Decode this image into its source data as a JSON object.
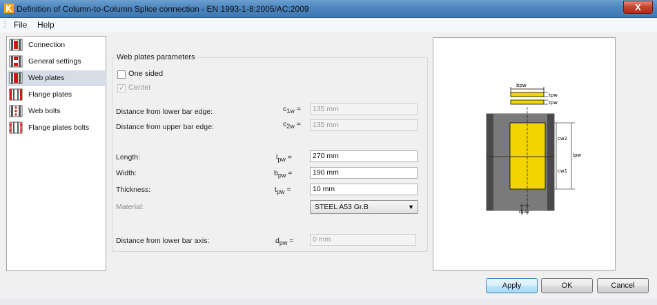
{
  "window": {
    "title": "Definition of Column-to-Column Splice connection - EN 1993-1-8:2005/AC:2009",
    "close_label": "X"
  },
  "menu": [
    "File",
    "Help"
  ],
  "sidebar": {
    "items": [
      {
        "label": "Connection",
        "selected": false
      },
      {
        "label": "General settings",
        "selected": false
      },
      {
        "label": "Web plates",
        "selected": true
      },
      {
        "label": "Flange plates",
        "selected": false
      },
      {
        "label": "Web bolts",
        "selected": false
      },
      {
        "label": "Flange plates bolts",
        "selected": false
      }
    ]
  },
  "panel": {
    "group_title": "Web plates parameters",
    "one_sided": {
      "label": "One sided",
      "checked": false
    },
    "center": {
      "label": "Center",
      "checked": true,
      "disabled": true
    },
    "rows": {
      "c1w": {
        "label": "Distance from lower bar edge:",
        "sym": "c",
        "sub": "1w",
        "value": "135 mm",
        "disabled": true
      },
      "c2w": {
        "label": "Distance from upper bar edge:",
        "sym": "c",
        "sub": "2w",
        "value": "135 mm",
        "disabled": true
      },
      "length": {
        "label": "Length:",
        "sym": "l",
        "sub": "pw",
        "value": "270 mm",
        "disabled": false
      },
      "width": {
        "label": "Width:",
        "sym": "b",
        "sub": "pw",
        "value": "190 mm",
        "disabled": false
      },
      "thickness": {
        "label": "Thickness:",
        "sym": "t",
        "sub": "pw",
        "value": "10 mm",
        "disabled": false
      },
      "dpw": {
        "label": "Distance from lower bar axis:",
        "sym": "d",
        "sub": "pw",
        "value": "0 mm",
        "disabled": true
      }
    },
    "eq": "=",
    "material": {
      "label": "Material:",
      "value": "STEEL A53 Gr.B"
    }
  },
  "diagram": {
    "labels": {
      "bpw": "bpw",
      "tpw1": "tpw",
      "tpw2": "tpw",
      "cw2": "cw2",
      "cw1": "cw1",
      "lpw": "lpw",
      "dpw": "dpw"
    },
    "colors": {
      "plate": "#f2d400",
      "column": "#6e6e6e",
      "column_dark": "#4a4a4a"
    }
  },
  "buttons": {
    "apply": "Apply",
    "ok": "OK",
    "cancel": "Cancel"
  }
}
